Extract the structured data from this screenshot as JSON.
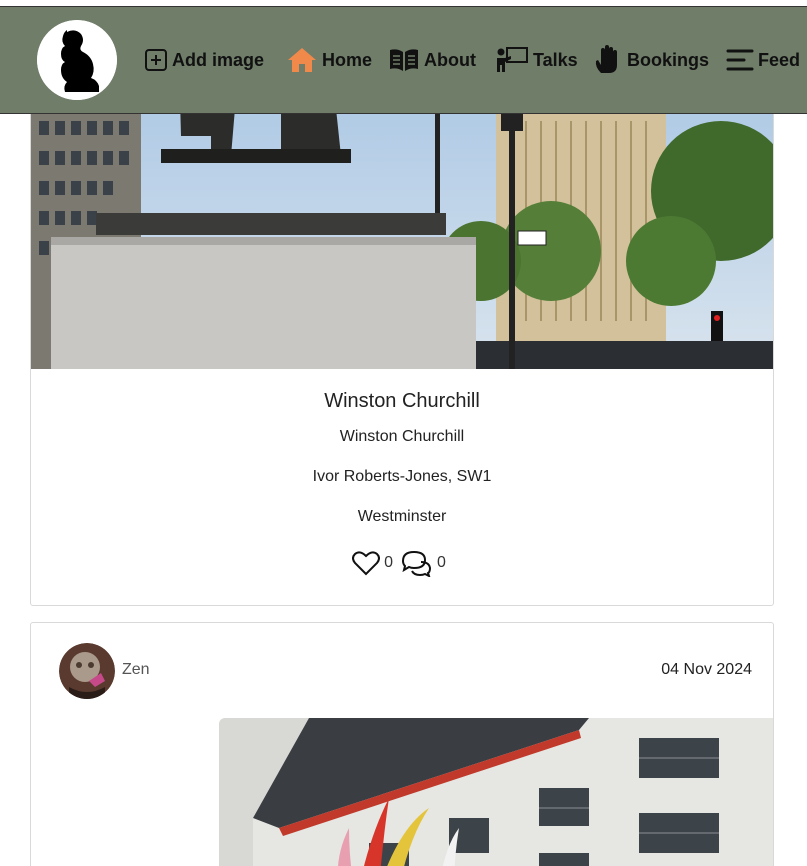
{
  "nav": {
    "items": [
      {
        "key": "add",
        "label": "Add image",
        "icon": "plus-square-icon"
      },
      {
        "key": "home",
        "label": "Home",
        "icon": "home-icon",
        "color": "#f0894a"
      },
      {
        "key": "about",
        "label": "About",
        "icon": "book-icon"
      },
      {
        "key": "talks",
        "label": "Talks",
        "icon": "presenter-icon"
      },
      {
        "key": "bookings",
        "label": "Bookings",
        "icon": "hand-icon"
      },
      {
        "key": "feed",
        "label": "Feed",
        "icon": "feed-lines-icon"
      }
    ],
    "background": "#6f7d69"
  },
  "posts": [
    {
      "title": "Winston Churchill",
      "subtitle": "Winston Churchill",
      "artist_location": "Ivor Roberts-Jones, SW1",
      "area": "Westminster",
      "likes": "0",
      "comments": "0"
    },
    {
      "author": "Zen",
      "date": "04 Nov 2024"
    }
  ]
}
